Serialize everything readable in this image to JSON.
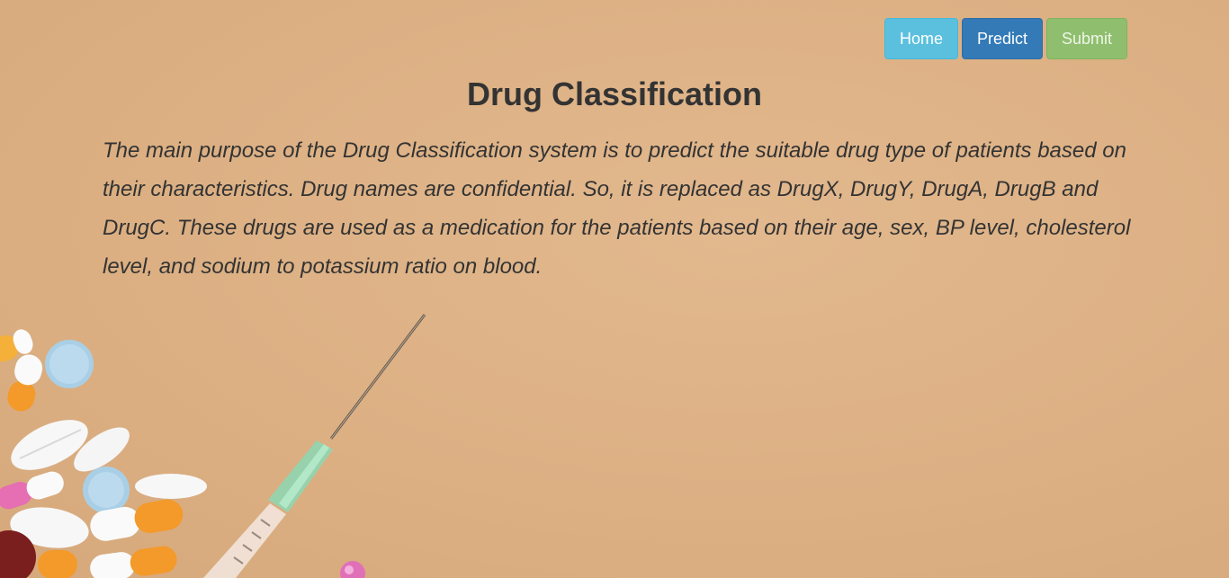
{
  "nav": {
    "home_label": "Home",
    "predict_label": "Predict",
    "submit_label": "Submit"
  },
  "page": {
    "title": "Drug Classification",
    "description": "The main purpose of the Drug Classification system is to predict the suitable drug type of patients based on their characteristics. Drug names are confidential. So, it is replaced as DrugX, DrugY, DrugA, DrugB and DrugC. These drugs are used as a medication for the patients based on their age, sex, BP level, cholesterol level, and sodium to potassium ratio on blood."
  },
  "colors": {
    "background": "#dcb083",
    "home_button": "#5bc0de",
    "predict_button": "#337ab7",
    "submit_button": "#8fbf6e",
    "text": "#333333"
  },
  "background_image": {
    "icons": [
      "pills-icon",
      "syringe-icon"
    ]
  }
}
